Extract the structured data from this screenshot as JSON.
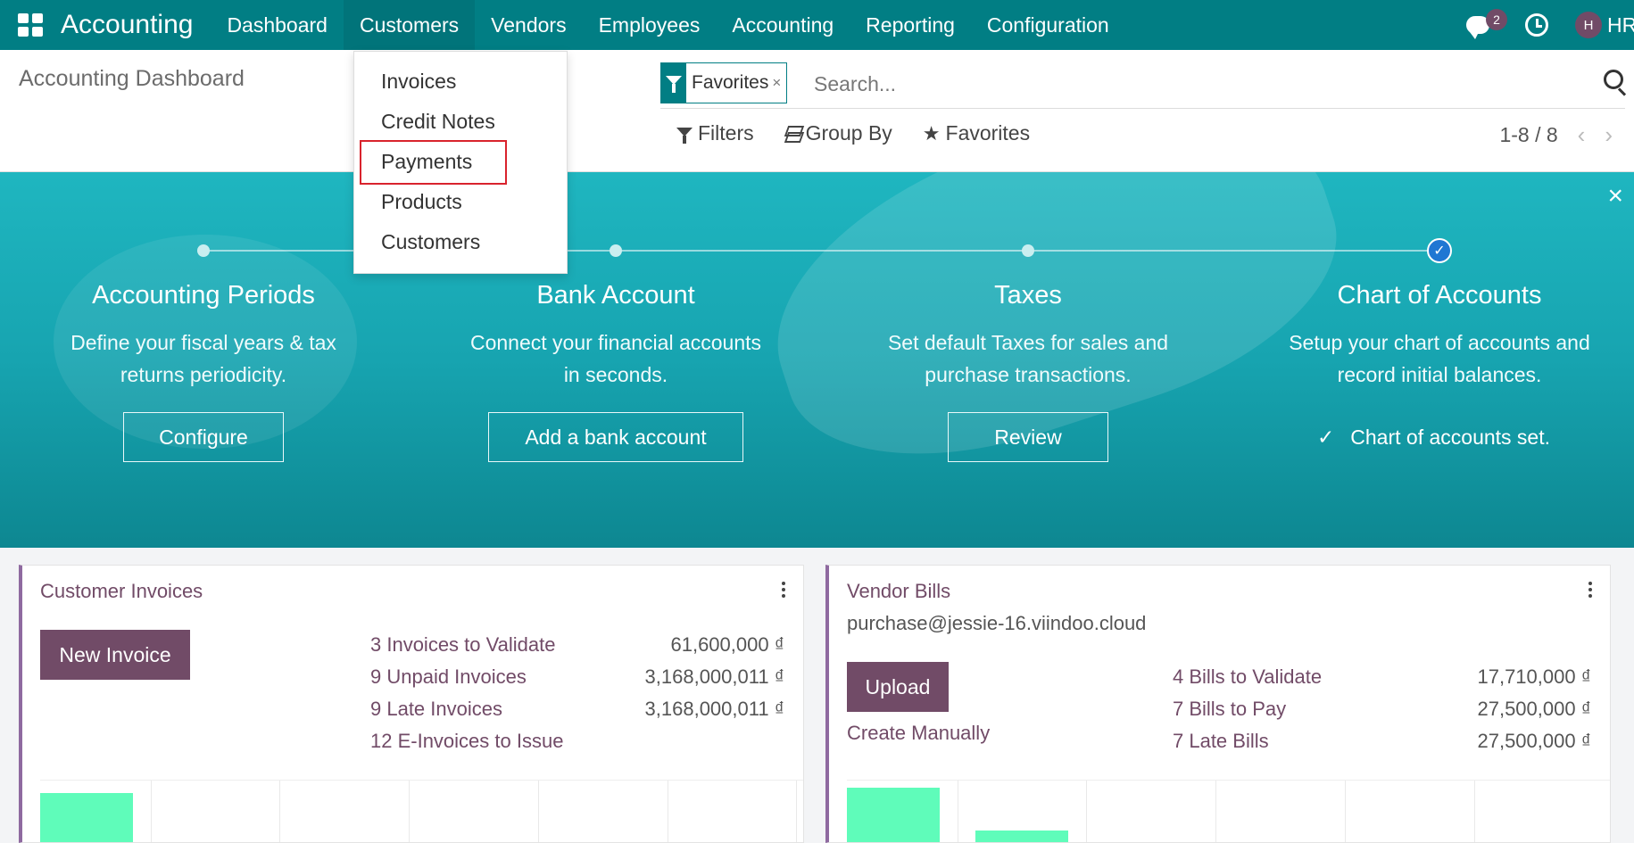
{
  "navbar": {
    "brand": "Accounting",
    "menu": [
      "Dashboard",
      "Customers",
      "Vendors",
      "Employees",
      "Accounting",
      "Reporting",
      "Configuration"
    ],
    "active_menu": "Customers",
    "chat_badge": "2",
    "avatar_initial": "H",
    "user_name": "HR"
  },
  "control_panel": {
    "title": "Accounting Dashboard",
    "facet_label": "Favorites",
    "facet_remove": "×",
    "search_placeholder": "Search...",
    "filters_label": "Filters",
    "group_by_label": "Group By",
    "favorites_label": "Favorites",
    "pager": "1-8 / 8",
    "pager_prev": "‹",
    "pager_next": "›"
  },
  "dropdown": {
    "items": [
      "Invoices",
      "Credit Notes",
      "Payments",
      "Products",
      "Customers"
    ],
    "highlighted": "Payments"
  },
  "banner": {
    "close": "×",
    "steps": [
      {
        "title": "Accounting Periods",
        "desc1": "Define your fiscal years & tax",
        "desc2": "returns periodicity.",
        "button": "Configure",
        "done": false
      },
      {
        "title": "Bank Account",
        "desc1": "Connect your financial accounts",
        "desc2": "in seconds.",
        "button": "Add a bank account",
        "done": false
      },
      {
        "title": "Taxes",
        "desc1": "Set default Taxes for sales and",
        "desc2": "purchase transactions.",
        "button": "Review",
        "done": false
      },
      {
        "title": "Chart of Accounts",
        "desc1": "Setup your chart of accounts and",
        "desc2": "record initial balances.",
        "status": "Chart of accounts set.",
        "done": true
      }
    ],
    "check": "✓"
  },
  "customer_invoices": {
    "title": "Customer Invoices",
    "new_button": "New Invoice",
    "stats": [
      {
        "label": "3 Invoices to Validate",
        "value": "61,600,000 ₫"
      },
      {
        "label": "9 Unpaid Invoices",
        "value": "3,168,000,011 ₫"
      },
      {
        "label": "9 Late Invoices",
        "value": "3,168,000,011 ₫"
      },
      {
        "label": "12 E-Invoices to Issue",
        "value": ""
      }
    ]
  },
  "vendor_bills": {
    "title": "Vendor Bills",
    "email": "purchase@jessie-16.viindoo.cloud",
    "upload_button": "Upload",
    "create_manually": "Create Manually",
    "stats": [
      {
        "label": "4 Bills to Validate",
        "value": "17,710,000 ₫"
      },
      {
        "label": "7 Bills to Pay",
        "value": "27,500,000 ₫"
      },
      {
        "label": "7 Late Bills",
        "value": "27,500,000 ₫"
      }
    ]
  },
  "colors": {
    "navbar": "#017e84",
    "brand_purple": "#714b67",
    "graph_bar": "#5ffcba",
    "highlight_border": "#d9232d"
  }
}
